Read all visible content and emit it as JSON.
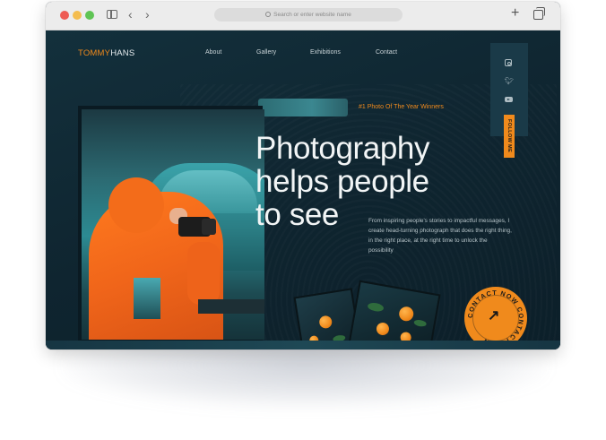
{
  "browser": {
    "address_placeholder": "Search or enter website name"
  },
  "site": {
    "logo": {
      "first": "TOMMY",
      "last": "HANS"
    },
    "nav": [
      {
        "label": "About"
      },
      {
        "label": "Gallery"
      },
      {
        "label": "Exhibitions"
      },
      {
        "label": "Contact"
      }
    ],
    "social": {
      "follow_label": "FOLLOW ME",
      "icons": [
        "instagram-icon",
        "twitter-icon",
        "youtube-icon"
      ]
    },
    "award": "#1 Photo Of The Year Winners",
    "headline": [
      "Photography",
      "helps people",
      "to see"
    ],
    "description": "From inspiring people's stories to impactful messages, I create head-turning photograph that does the right thing, in the right place, at the right time to unlock the possibility",
    "contact_badge": "CONTACT NOW CONTACT NOW ",
    "colors": {
      "accent": "#f08a1c",
      "background": "#0f2530",
      "text": "#f2f5f6"
    }
  }
}
